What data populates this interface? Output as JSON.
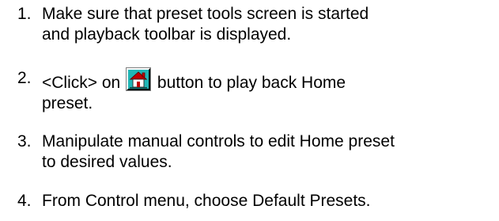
{
  "steps": [
    {
      "number": "1.",
      "lines": [
        "Make sure that preset tools screen is started",
        "and playback toolbar is displayed."
      ]
    },
    {
      "number": "2.",
      "before_icon": "<Click> on",
      "icon": "home-preset-icon",
      "after_icon": "button to play back Home",
      "continuation": "preset."
    },
    {
      "number": "3.",
      "lines": [
        "Manipulate manual controls to edit Home preset",
        "to desired values."
      ]
    },
    {
      "number": "4.",
      "lines": [
        "From Control menu, choose Default Presets."
      ]
    }
  ],
  "colors": {
    "text": "#000000",
    "background": "#ffffff",
    "icon_face": "#20b6b6",
    "icon_roof": "#c00000",
    "icon_wall": "#ffffff"
  }
}
